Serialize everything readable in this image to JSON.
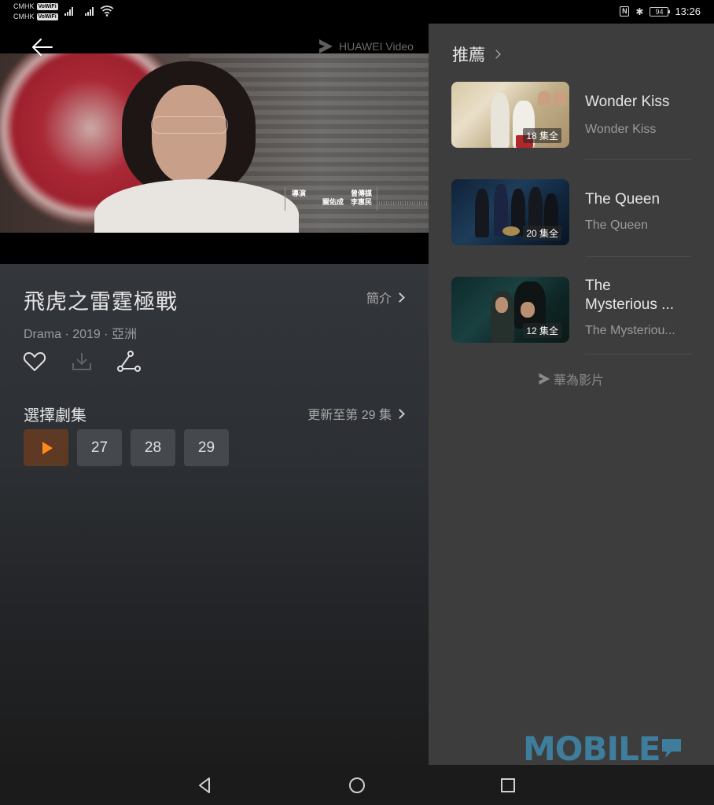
{
  "status_bar": {
    "carriers": [
      {
        "name": "CMHK",
        "badge": "VoWiFi"
      },
      {
        "name": "CMHK",
        "badge": "VoWiFi"
      }
    ],
    "icons": [
      "signal-icon",
      "signal-icon",
      "wifi-icon",
      "nfc-icon",
      "bluetooth-icon",
      "battery-icon"
    ],
    "nfc_label": "N",
    "bluetooth_glyph": "✱",
    "battery_level": "94",
    "time": "13:26"
  },
  "player": {
    "watermark": "HUAWEI Video",
    "credits": {
      "label": "導演",
      "names_line1": "曾傳謀",
      "names_line2": "關佑成　李惠民"
    }
  },
  "details": {
    "title": "飛虎之雷霆極戰",
    "intro_label": "簡介",
    "meta": "Drama · 2019 · 亞洲",
    "actions": [
      "favorite",
      "download",
      "share"
    ]
  },
  "episodes": {
    "header": "選擇劇集",
    "update_label": "更新至第 29 集",
    "items": [
      {
        "label": "",
        "type": "play"
      },
      {
        "label": "27",
        "type": "episode"
      },
      {
        "label": "28",
        "type": "episode"
      },
      {
        "label": "29",
        "type": "episode"
      }
    ]
  },
  "recommendations": {
    "header": "推薦",
    "items": [
      {
        "title": "Wonder Kiss",
        "subtitle": "Wonder Kiss",
        "badge": "18 集全"
      },
      {
        "title": "The Queen",
        "subtitle": "The Queen",
        "badge": "20 集全"
      },
      {
        "title": "The Mysterious ...",
        "subtitle": "The Mysteriou...",
        "badge": "12 集全"
      }
    ],
    "footer_brand": "華為影片"
  },
  "overlay_logo": "MOBILE",
  "colors": {
    "accent_orange": "#ff8a1a",
    "play_button_bg": "#5e3a24",
    "episode_bg": "#45484d",
    "panel_bg": "#3d3d3d",
    "logo_blue": "#3e7e9c"
  },
  "nav_bar": {
    "buttons": [
      "back",
      "home",
      "recents"
    ]
  }
}
